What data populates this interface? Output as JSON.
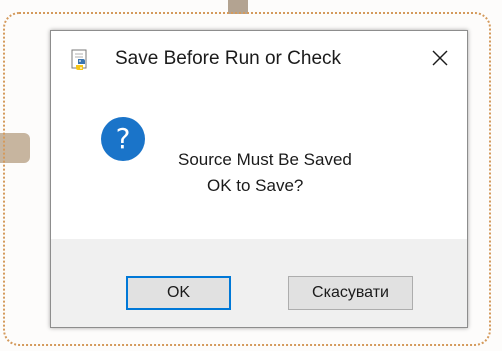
{
  "dialog": {
    "title": "Save Before Run or Check",
    "message_line1": "Source Must Be Saved",
    "message_line2": "OK to Save?",
    "question_glyph": "?",
    "close_glyph": "✕",
    "ok_label": "OK",
    "cancel_label": "Скасувати",
    "title_icon": "python-idle-icon",
    "message_icon": "question-icon"
  },
  "colors": {
    "accent": "#0078d7",
    "question_icon": "#1a74c9",
    "frame_decoration": "#d49a5c"
  }
}
